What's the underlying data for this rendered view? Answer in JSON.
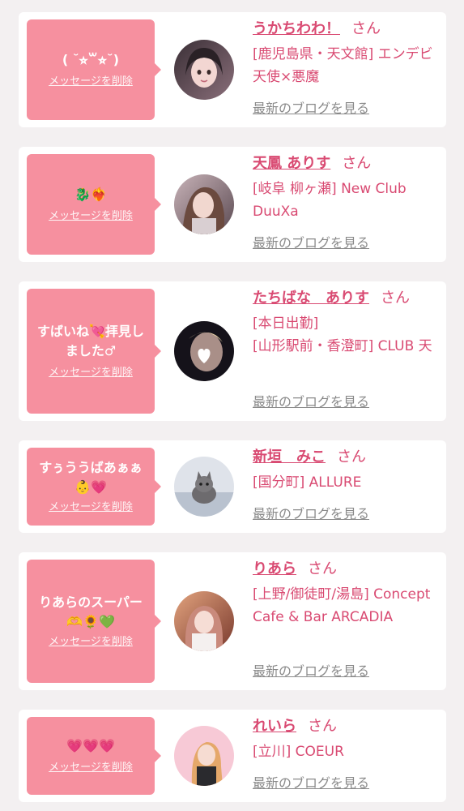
{
  "colors": {
    "background": "#f3f0f1",
    "card": "#ffffff",
    "bubble": "#f6909f",
    "accent": "#d94a72",
    "link_gray": "#8a8a8a"
  },
  "labels": {
    "delete": "メッセージを削除",
    "blog": "最新のブログを見る",
    "honorific": "さん"
  },
  "cards": [
    {
      "message": "( ˘⭐︎꒳⭐︎˘)",
      "name": "うかちわわ！",
      "shop_lines": [
        "[鹿児島県・天文館] エンデビ　天使×悪魔"
      ],
      "avatar_icon": "avatar-photo-girl"
    },
    {
      "message": "🐉❤️‍🔥",
      "name": "天鳳 ありす",
      "shop_lines": [
        "[岐阜 柳ヶ瀬] New Club DuuXa"
      ],
      "avatar_icon": "avatar-photo-girl"
    },
    {
      "message": "すばいね💘拝見しました♂",
      "name": "たちばな　ありす",
      "shop_lines": [
        "[本日出勤]",
        "[山形駅前・香澄町] CLUB 天"
      ],
      "avatar_icon": "avatar-photo-heart"
    },
    {
      "message": "すぅううばあぁぁ👶💗",
      "name": "新垣　みこ",
      "shop_lines": [
        "[国分町] ALLURE"
      ],
      "avatar_icon": "avatar-photo-kitten"
    },
    {
      "message": "りあらのスーパー🫶🌻💚",
      "name": "りあら",
      "shop_lines": [
        "[上野/御徒町/湯島] Concept Cafe & Bar ARCADIA"
      ],
      "avatar_icon": "avatar-photo-girl"
    },
    {
      "message": "💗💗💗",
      "name": "れいら",
      "shop_lines": [
        "[立川] COEUR"
      ],
      "avatar_icon": "avatar-photo-girl"
    }
  ]
}
